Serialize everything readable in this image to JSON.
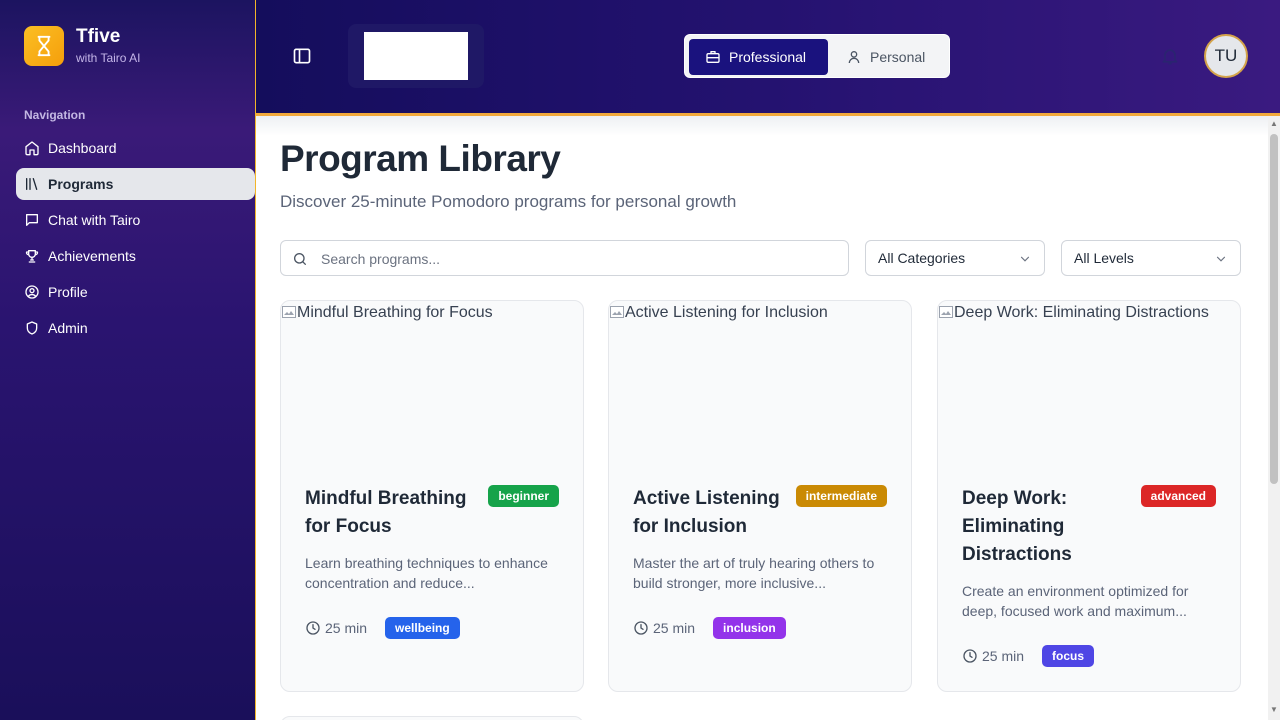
{
  "brand": {
    "name": "Tfive",
    "subtitle": "with Tairo AI"
  },
  "sidebar": {
    "heading": "Navigation",
    "items": [
      {
        "label": "Dashboard",
        "icon": "home-icon",
        "active": false
      },
      {
        "label": "Programs",
        "icon": "library-icon",
        "active": true
      },
      {
        "label": "Chat with Tairo",
        "icon": "chat-icon",
        "active": false
      },
      {
        "label": "Achievements",
        "icon": "trophy-icon",
        "active": false
      },
      {
        "label": "Profile",
        "icon": "user-circle-icon",
        "active": false
      },
      {
        "label": "Admin",
        "icon": "shield-icon",
        "active": false
      }
    ]
  },
  "header": {
    "mode_professional": "Professional",
    "mode_personal": "Personal",
    "active_mode": "Professional",
    "avatar_initials": "TU"
  },
  "main": {
    "title": "Program Library",
    "subtitle": "Discover 25-minute Pomodoro programs for personal growth",
    "search_placeholder": "Search programs...",
    "category_filter": "All Categories",
    "level_filter": "All Levels"
  },
  "programs": [
    {
      "image_alt": "Mindful Breathing for Focus",
      "title": "Mindful Breathing for Focus",
      "level": "beginner",
      "level_color": "#16a34a",
      "description": "Learn breathing techniques to enhance concentration and reduce...",
      "duration": "25 min",
      "category": "wellbeing",
      "category_color": "#2563eb"
    },
    {
      "image_alt": "Active Listening for Inclusion",
      "title": "Active Listening for Inclusion",
      "level": "intermediate",
      "level_color": "#ca8a04",
      "description": "Master the art of truly hearing others to build stronger, more inclusive...",
      "duration": "25 min",
      "category": "inclusion",
      "category_color": "#9333ea"
    },
    {
      "image_alt": "Deep Work: Eliminating Distractions",
      "title": "Deep Work: Eliminating Distractions",
      "level": "advanced",
      "level_color": "#dc2626",
      "description": "Create an environment optimized for deep, focused work and maximum...",
      "duration": "25 min",
      "category": "focus",
      "category_color": "#4f46e5"
    }
  ]
}
